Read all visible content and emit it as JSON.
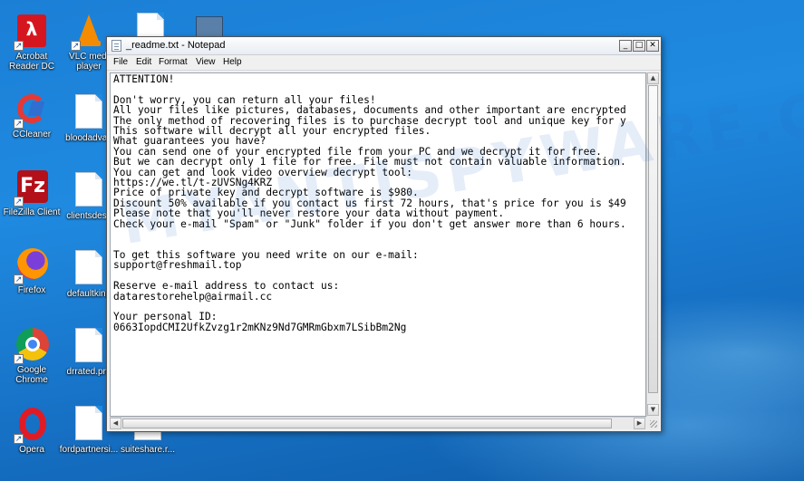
{
  "desktop": {
    "icons_left": [
      {
        "name": "acrobat",
        "label": "Acrobat\nReader DC"
      },
      {
        "name": "ccleaner",
        "label": "CCleaner"
      },
      {
        "name": "filezilla",
        "label": "FileZilla Client"
      },
      {
        "name": "firefox",
        "label": "Firefox"
      },
      {
        "name": "chrome",
        "label": "Google\nChrome"
      },
      {
        "name": "opera",
        "label": "Opera"
      }
    ],
    "icons_second": [
      {
        "name": "vlc",
        "label": "VLC medi\nplayer"
      },
      {
        "name": "bloodadvan",
        "label": "bloodadvan"
      },
      {
        "name": "clientsdesc",
        "label": "clientsdesc"
      },
      {
        "name": "defaultking",
        "label": "defaultking"
      },
      {
        "name": "drrated",
        "label": "drrated.pra"
      },
      {
        "name": "fordpartner",
        "label": "fordpartnersi..."
      }
    ],
    "icons_third": [
      {
        "name": "suiteshare",
        "label": "suiteshare.r..."
      }
    ]
  },
  "window": {
    "title": "_readme.txt - Notepad",
    "buttons": {
      "minimize": "_",
      "maximize": "□",
      "close": "✕"
    },
    "menu": [
      "File",
      "Edit",
      "Format",
      "View",
      "Help"
    ],
    "content_lines": [
      "ATTENTION!",
      "",
      "Don't worry, you can return all your files!",
      "All your files like pictures, databases, documents and other important are encrypted",
      "The only method of recovering files is to purchase decrypt tool and unique key for y",
      "This software will decrypt all your encrypted files.",
      "What guarantees you have?",
      "You can send one of your encrypted file from your PC and we decrypt it for free.",
      "But we can decrypt only 1 file for free. File must not contain valuable information.",
      "You can get and look video overview decrypt tool:",
      "https://we.tl/t-zUVSNg4KRZ",
      "Price of private key and decrypt software is $980.",
      "Discount 50% available if you contact us first 72 hours, that's price for you is $49",
      "Please note that you'll never restore your data without payment.",
      "Check your e-mail \"Spam\" or \"Junk\" folder if you don't get answer more than 6 hours.",
      "",
      "",
      "To get this software you need write on our e-mail:",
      "support@freshmail.top",
      "",
      "Reserve e-mail address to contact us:",
      "datarestorehelp@airmail.cc",
      "",
      "Your personal ID:",
      "0663IopdCMI2UfkZvzg1r2mKNz9Nd7GMRmGbxm7LSibBm2Ng"
    ]
  },
  "watermark": "MYANTISPYWARE.C"
}
